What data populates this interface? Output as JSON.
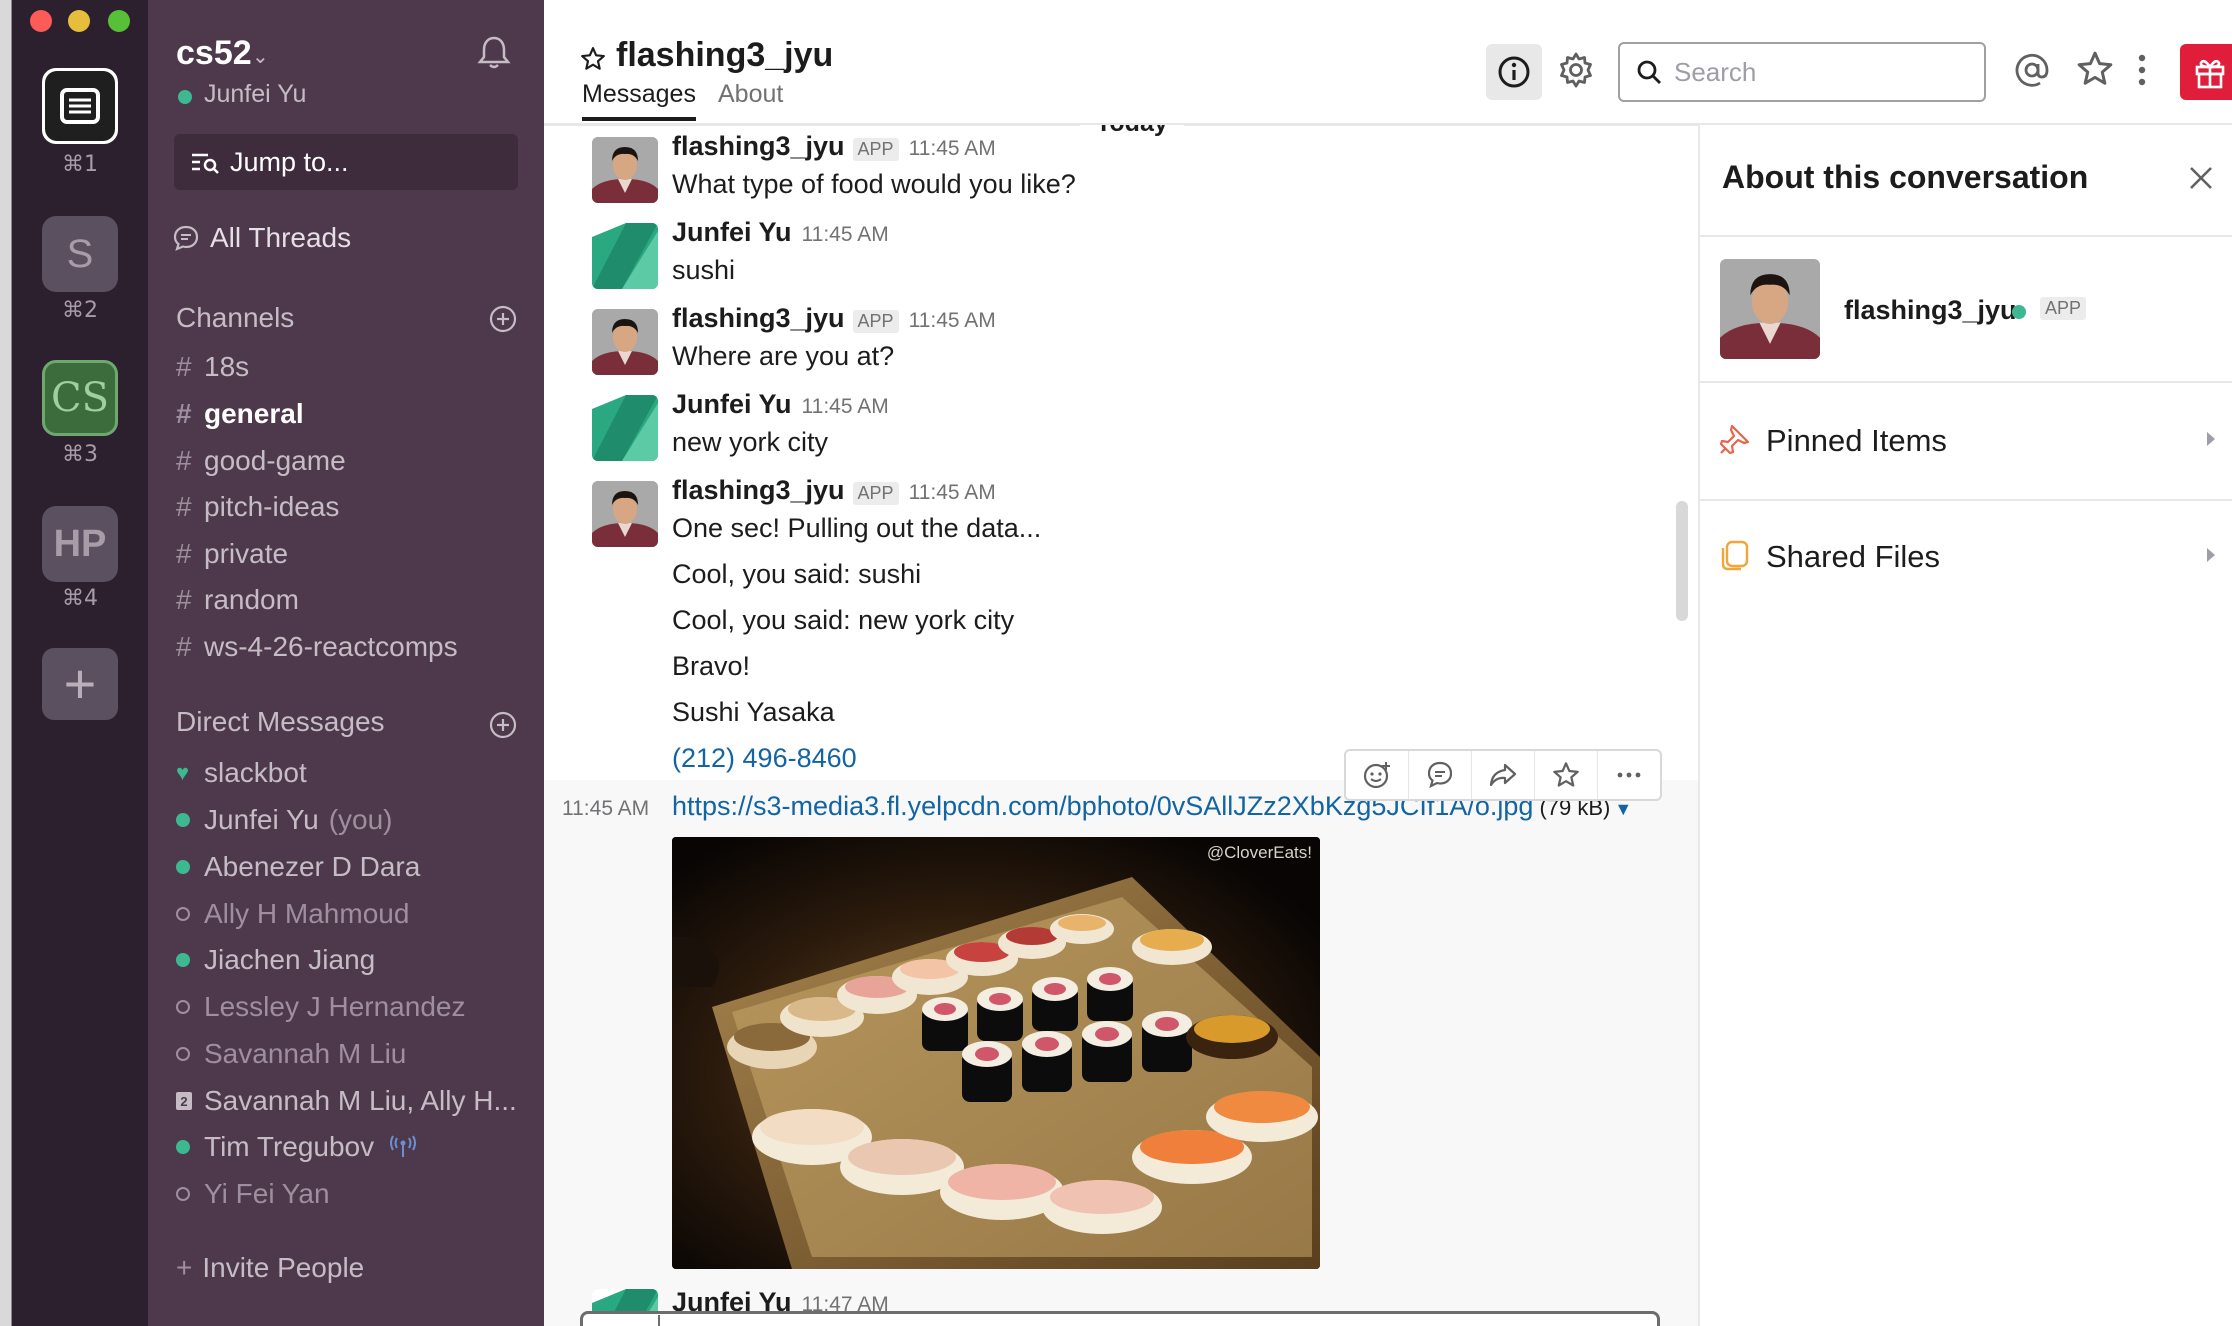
{
  "team_rail": {
    "teams": [
      {
        "shortcut": "⌘1",
        "initials": ""
      },
      {
        "shortcut": "⌘2",
        "initials": "S"
      },
      {
        "shortcut": "⌘3",
        "initials": "CS"
      },
      {
        "shortcut": "⌘4",
        "initials": "HP"
      }
    ],
    "add_label": "+"
  },
  "sidebar": {
    "team_name": "cs52",
    "user_name": "Junfei Yu",
    "jump_to": "Jump to...",
    "all_threads": "All Threads",
    "channels_header": "Channels",
    "channels": [
      {
        "name": "18s",
        "active": false
      },
      {
        "name": "general",
        "active": true
      },
      {
        "name": "good-game",
        "active": false
      },
      {
        "name": "pitch-ideas",
        "active": false
      },
      {
        "name": "private",
        "active": false
      },
      {
        "name": "random",
        "active": false
      },
      {
        "name": "ws-4-26-reactcomps",
        "active": false
      }
    ],
    "hash": "#",
    "dms_header": "Direct Messages",
    "dms": [
      {
        "name": "slackbot",
        "status": "bot"
      },
      {
        "name": "Junfei Yu",
        "suffix": "(you)",
        "status": "online"
      },
      {
        "name": "Abenezer D Dara",
        "status": "online"
      },
      {
        "name": "Ally H Mahmoud",
        "status": "away"
      },
      {
        "name": "Jiachen Jiang",
        "status": "online"
      },
      {
        "name": "Lessley J Hernandez",
        "status": "away"
      },
      {
        "name": "Savannah M Liu",
        "status": "away"
      },
      {
        "name": "Savannah M Liu, Ally H...",
        "status": "group",
        "count": "2"
      },
      {
        "name": "Tim Tregubov",
        "status": "online"
      },
      {
        "name": "Yi Fei Yan",
        "status": "away"
      }
    ],
    "invite": "Invite People"
  },
  "header": {
    "channel": "flashing3_jyu",
    "tab_messages": "Messages",
    "tab_about": "About",
    "search_placeholder": "Search"
  },
  "messages": {
    "day_divider": "Today",
    "items": [
      {
        "author": "flashing3_jyu",
        "app": "APP",
        "time": "11:45 AM",
        "text": "What type of food would you like?"
      },
      {
        "author": "Junfei Yu",
        "time": "11:45 AM",
        "text": "sushi"
      },
      {
        "author": "flashing3_jyu",
        "app": "APP",
        "time": "11:45 AM",
        "text": "Where are you at?"
      },
      {
        "author": "Junfei Yu",
        "time": "11:45 AM",
        "text": "new york city"
      },
      {
        "author": "flashing3_jyu",
        "app": "APP",
        "time": "11:45 AM",
        "text": "One sec! Pulling out the data..."
      }
    ],
    "followups": [
      "Cool, you said: sushi",
      "Cool, you said: new york city",
      "Bravo!",
      "Sushi Yasaka"
    ],
    "phone": "(212) 496-8460",
    "hover_time": "11:45 AM",
    "url": "https://s3-media3.fl.yelpcdn.com/bphoto/0vSAllJZz2XbKzg5JCIf1A/o.jpg",
    "file_size": "(79 kB)",
    "image_credit": "@CloverEats!",
    "next_author": "Junfei Yu",
    "next_time": "11:47 AM"
  },
  "details": {
    "title": "About this conversation",
    "bot_name": "flashing3_jyu",
    "bot_app": "APP",
    "pinned": "Pinned Items",
    "shared": "Shared Files"
  },
  "colors": {
    "sidebar_bg": "#4d394b",
    "rail_bg": "#2c1f2e",
    "online": "#3eb890",
    "link": "#1264a3",
    "gift": "#e01e3c"
  }
}
